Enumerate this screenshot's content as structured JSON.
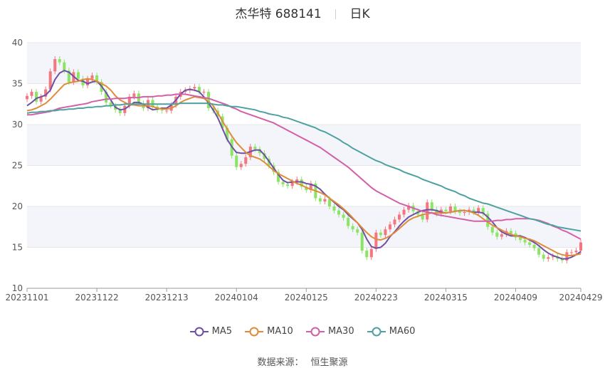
{
  "header": {
    "stock_name": "杰华特",
    "stock_code": "688141",
    "period": "日K"
  },
  "chart_data": {
    "type": "candlestick",
    "title": "杰华特 688141 日K",
    "ylim": [
      10,
      40
    ],
    "y_ticks": [
      10,
      15,
      20,
      25,
      30,
      35,
      40
    ],
    "x_tick_labels": [
      "20231101",
      "20231122",
      "20231213",
      "20240104",
      "20240125",
      "20240223",
      "20240315",
      "20240409",
      "20240429"
    ],
    "x_tick_indices": [
      0,
      15,
      30,
      45,
      60,
      75,
      90,
      105,
      119
    ],
    "grid": true,
    "legend_position": "bottom",
    "colors": {
      "up": "#f4777f",
      "down": "#8be564",
      "MA5": "#6e4fa3",
      "MA10": "#df8c3a",
      "MA30": "#d35fa8",
      "MA60": "#4ea1a1",
      "band": "#f4f5fa",
      "grid": "#e6e6e6"
    },
    "close": [
      33.5,
      34.0,
      32.8,
      33.4,
      34.3,
      36.5,
      38.0,
      37.6,
      36.6,
      35.2,
      36.4,
      35.6,
      34.8,
      35.6,
      36.0,
      35.2,
      34.0,
      32.7,
      32.3,
      31.8,
      31.4,
      32.3,
      33.4,
      33.8,
      32.6,
      32.0,
      33.0,
      32.2,
      31.8,
      31.7,
      31.7,
      32.4,
      33.4,
      34.0,
      34.2,
      34.4,
      34.6,
      34.0,
      34.0,
      32.0,
      31.7,
      31.0,
      29.6,
      28.2,
      26.2,
      24.8,
      25.2,
      26.0,
      27.3,
      27.0,
      26.5,
      25.8,
      25.0,
      24.2,
      23.0,
      22.7,
      22.5,
      23.0,
      23.3,
      22.4,
      22.0,
      22.8,
      21.0,
      20.6,
      20.9,
      20.0,
      19.5,
      19.0,
      18.6,
      17.6,
      17.2,
      16.8,
      14.6,
      13.8,
      14.8,
      16.8,
      16.5,
      17.2,
      17.8,
      18.4,
      19.0,
      19.6,
      20.1,
      19.4,
      19.0,
      18.4,
      20.5,
      19.6,
      19.1,
      19.6,
      19.4,
      20.0,
      19.4,
      19.2,
      19.3,
      19.6,
      19.3,
      19.8,
      19.1,
      17.5,
      16.8,
      16.3,
      16.6,
      17.0,
      16.7,
      16.2,
      15.9,
      15.6,
      15.3,
      14.9,
      14.1,
      13.6,
      13.8,
      13.9,
      13.6,
      13.4,
      14.4,
      14.4,
      14.6,
      15.6
    ],
    "series": [
      {
        "name": "MA5",
        "values": [
          32.3,
          32.7,
          33.2,
          33.4,
          33.6,
          34.2,
          35.5,
          36.3,
          36.6,
          36.4,
          35.9,
          35.4,
          35.3,
          35.0,
          35.2,
          35.3,
          34.7,
          33.9,
          33.0,
          32.1,
          31.8,
          31.9,
          32.3,
          32.7,
          32.7,
          32.5,
          32.1,
          31.8,
          31.9,
          32.0,
          32.0,
          32.4,
          33.0,
          33.7,
          34.2,
          34.3,
          34.2,
          34.0,
          33.4,
          32.6,
          31.8,
          30.8,
          29.5,
          28.2,
          27.3,
          26.6,
          26.5,
          26.5,
          26.7,
          26.9,
          26.9,
          26.3,
          25.5,
          24.7,
          23.9,
          23.2,
          22.9,
          23.0,
          23.0,
          23.0,
          22.8,
          22.7,
          22.5,
          22.1,
          21.5,
          21.0,
          20.5,
          20.0,
          19.6,
          19.0,
          18.5,
          18.0,
          17.2,
          16.0,
          15.1,
          14.9,
          15.0,
          15.5,
          16.3,
          16.9,
          17.6,
          18.2,
          18.7,
          19.0,
          19.3,
          19.5,
          19.6,
          19.6,
          19.5,
          19.3,
          19.2,
          19.3,
          19.4,
          19.5,
          19.5,
          19.4,
          19.3,
          19.3,
          19.2,
          18.7,
          18.1,
          17.4,
          16.9,
          16.6,
          16.4,
          16.4,
          16.4,
          16.2,
          15.9,
          15.6,
          15.2,
          14.7,
          14.3,
          14.0,
          13.8,
          13.6,
          13.6,
          13.8,
          14.1,
          14.5
        ]
      },
      {
        "name": "MA10",
        "values": [
          31.7,
          31.8,
          32.0,
          32.3,
          32.6,
          33.1,
          33.7,
          34.3,
          34.9,
          35.1,
          35.2,
          35.3,
          35.5,
          35.6,
          35.5,
          35.3,
          35.0,
          34.7,
          34.2,
          33.5,
          33.0,
          32.7,
          32.4,
          32.4,
          32.3,
          32.3,
          32.3,
          32.2,
          32.0,
          31.9,
          31.9,
          32.0,
          32.3,
          32.7,
          33.0,
          33.2,
          33.4,
          33.3,
          33.2,
          32.8,
          32.3,
          31.4,
          30.4,
          29.5,
          28.6,
          27.8,
          27.2,
          26.6,
          26.2,
          26.0,
          25.8,
          25.4,
          24.9,
          24.4,
          24.0,
          23.7,
          23.4,
          23.1,
          22.8,
          22.6,
          22.3,
          22.1,
          21.9,
          21.7,
          21.4,
          21.0,
          20.6,
          20.2,
          19.7,
          19.2,
          18.6,
          18.0,
          17.4,
          16.8,
          16.3,
          16.0,
          15.9,
          16.1,
          16.4,
          16.8,
          17.3,
          17.8,
          18.3,
          18.6,
          18.8,
          19.0,
          19.1,
          19.2,
          19.2,
          19.2,
          19.2,
          19.3,
          19.4,
          19.5,
          19.5,
          19.4,
          19.2,
          18.9,
          18.5,
          18.1,
          17.7,
          17.4,
          17.1,
          16.8,
          16.6,
          16.4,
          16.3,
          16.1,
          16.0,
          15.8,
          15.5,
          15.2,
          14.9,
          14.6,
          14.3,
          14.1,
          14.0,
          14.0,
          14.1,
          14.2
        ]
      },
      {
        "name": "MA30",
        "values": [
          31.2,
          31.2,
          31.3,
          31.4,
          31.5,
          31.6,
          31.8,
          32.0,
          32.1,
          32.2,
          32.3,
          32.4,
          32.5,
          32.6,
          32.8,
          32.9,
          33.0,
          33.1,
          33.1,
          33.2,
          33.2,
          33.2,
          33.3,
          33.3,
          33.3,
          33.4,
          33.4,
          33.4,
          33.5,
          33.5,
          33.6,
          33.6,
          33.7,
          33.7,
          33.7,
          33.6,
          33.5,
          33.4,
          33.3,
          33.2,
          33.0,
          32.8,
          32.6,
          32.4,
          32.1,
          31.9,
          31.6,
          31.4,
          31.2,
          31.0,
          30.8,
          30.6,
          30.4,
          30.2,
          29.9,
          29.6,
          29.3,
          29.0,
          28.7,
          28.4,
          28.1,
          27.8,
          27.5,
          27.2,
          26.8,
          26.4,
          26.0,
          25.6,
          25.2,
          24.8,
          24.3,
          23.8,
          23.3,
          22.8,
          22.3,
          21.9,
          21.6,
          21.3,
          21.0,
          20.7,
          20.4,
          20.2,
          20.0,
          19.8,
          19.6,
          19.4,
          19.3,
          19.2,
          19.0,
          18.9,
          18.8,
          18.7,
          18.6,
          18.5,
          18.4,
          18.3,
          18.2,
          18.2,
          18.2,
          18.2,
          18.2,
          18.3,
          18.3,
          18.4,
          18.4,
          18.5,
          18.5,
          18.5,
          18.5,
          18.4,
          18.3,
          18.1,
          17.9,
          17.6,
          17.4,
          17.1,
          16.9,
          16.6,
          16.3,
          16.0
        ]
      },
      {
        "name": "MA60",
        "values": [
          31.4,
          31.5,
          31.5,
          31.6,
          31.6,
          31.7,
          31.7,
          31.8,
          31.8,
          31.9,
          31.9,
          32.0,
          32.0,
          32.1,
          32.1,
          32.2,
          32.2,
          32.3,
          32.3,
          32.4,
          32.4,
          32.5,
          32.5,
          32.5,
          32.5,
          32.5,
          32.5,
          32.5,
          32.5,
          32.5,
          32.5,
          32.5,
          32.5,
          32.6,
          32.6,
          32.6,
          32.6,
          32.6,
          32.6,
          32.6,
          32.5,
          32.4,
          32.4,
          32.3,
          32.2,
          32.2,
          32.1,
          32.0,
          31.9,
          31.8,
          31.6,
          31.5,
          31.3,
          31.2,
          31.1,
          30.9,
          30.8,
          30.6,
          30.4,
          30.2,
          30.0,
          29.8,
          29.6,
          29.3,
          29.1,
          28.8,
          28.5,
          28.2,
          27.8,
          27.5,
          27.1,
          26.8,
          26.5,
          26.2,
          25.9,
          25.6,
          25.4,
          25.1,
          24.9,
          24.7,
          24.5,
          24.2,
          24.0,
          23.8,
          23.6,
          23.3,
          23.1,
          22.9,
          22.7,
          22.5,
          22.2,
          22.0,
          21.8,
          21.5,
          21.3,
          21.0,
          20.8,
          20.6,
          20.4,
          20.3,
          20.1,
          19.9,
          19.7,
          19.5,
          19.3,
          19.1,
          18.9,
          18.7,
          18.5,
          18.4,
          18.2,
          18.0,
          17.8,
          17.7,
          17.5,
          17.4,
          17.3,
          17.2,
          17.1,
          17.0
        ]
      }
    ]
  },
  "legend": {
    "items": [
      {
        "label": "MA5",
        "color": "#6e4fa3"
      },
      {
        "label": "MA10",
        "color": "#df8c3a"
      },
      {
        "label": "MA30",
        "color": "#d35fa8"
      },
      {
        "label": "MA60",
        "color": "#4ea1a1"
      }
    ]
  },
  "footer": {
    "source_label": "数据来源：",
    "source_value": "恒生聚源"
  }
}
